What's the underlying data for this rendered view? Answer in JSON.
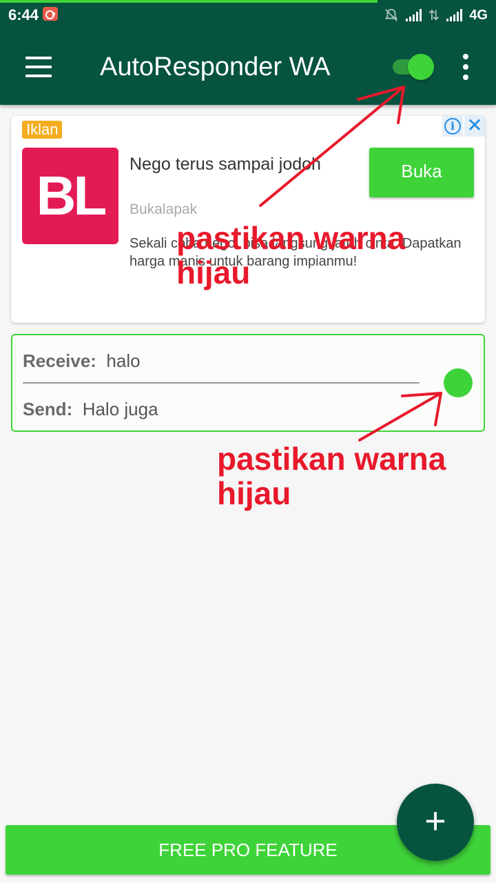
{
  "status_bar": {
    "time": "6:44",
    "network": "4G",
    "icons": [
      "screen-record-icon",
      "notifications-off-icon",
      "signal-icon",
      "data-transfer-icon",
      "signal-icon"
    ]
  },
  "app_bar": {
    "title": "AutoResponder WA",
    "toggle_on": true,
    "accent_color": "#3fd33a",
    "bar_color": "#065340"
  },
  "ad": {
    "badge": "Iklan",
    "logo_text": "BL",
    "headline": "Nego terus sampai jodoh",
    "advertiser": "Bukalapak",
    "description": "Sekali coba nego, bisa langsung jatuh cinta. Dapatkan harga manis untuk barang impianmu!",
    "button_label": "Buka",
    "info_label": "i",
    "close_label": "✕"
  },
  "rule": {
    "receive_label": "Receive:",
    "receive_value": "halo",
    "send_label": "Send:",
    "send_value": "Halo juga",
    "active": true
  },
  "annotations": [
    "pastikan warna hijau",
    "pastikan warna hijau"
  ],
  "bottom": {
    "pro_label": "FREE PRO FEATURE",
    "fab_label": "+"
  }
}
